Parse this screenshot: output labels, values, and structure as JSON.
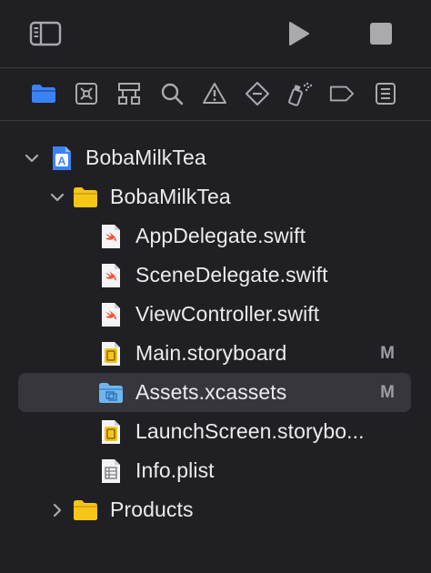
{
  "colors": {
    "background": "#1f1f24",
    "accent": "#3b82f6",
    "folder": "#f5c518",
    "swift": "#f05138",
    "selection": "#36363c",
    "icon_gray": "#a9a9ae"
  },
  "toolbar": {
    "sidebar_toggle_icon": "sidebar-icon",
    "run_icon": "play-icon",
    "stop_icon": "stop-icon"
  },
  "navigator_tabs": [
    {
      "icon": "folder-icon",
      "active": true
    },
    {
      "icon": "source-control-icon",
      "active": false
    },
    {
      "icon": "symbol-hierarchy-icon",
      "active": false
    },
    {
      "icon": "search-icon",
      "active": false
    },
    {
      "icon": "warning-icon",
      "active": false
    },
    {
      "icon": "test-diamond-icon",
      "active": false
    },
    {
      "icon": "debug-spray-icon",
      "active": false
    },
    {
      "icon": "breakpoint-icon",
      "active": false
    },
    {
      "icon": "report-list-icon",
      "active": false
    }
  ],
  "tree": {
    "project": {
      "label": "BobaMilkTea",
      "expanded": true
    },
    "group": {
      "label": "BobaMilkTea",
      "expanded": true
    },
    "files": [
      {
        "label": "AppDelegate.swift",
        "kind": "swift",
        "badge": ""
      },
      {
        "label": "SceneDelegate.swift",
        "kind": "swift",
        "badge": ""
      },
      {
        "label": "ViewController.swift",
        "kind": "swift",
        "badge": ""
      },
      {
        "label": "Main.storyboard",
        "kind": "storyboard",
        "badge": "M"
      },
      {
        "label": "Assets.xcassets",
        "kind": "assets",
        "badge": "M",
        "selected": true
      },
      {
        "label": "LaunchScreen.storybo...",
        "kind": "storyboard",
        "badge": ""
      },
      {
        "label": "Info.plist",
        "kind": "plist",
        "badge": ""
      }
    ],
    "products": {
      "label": "Products",
      "expanded": false
    }
  }
}
